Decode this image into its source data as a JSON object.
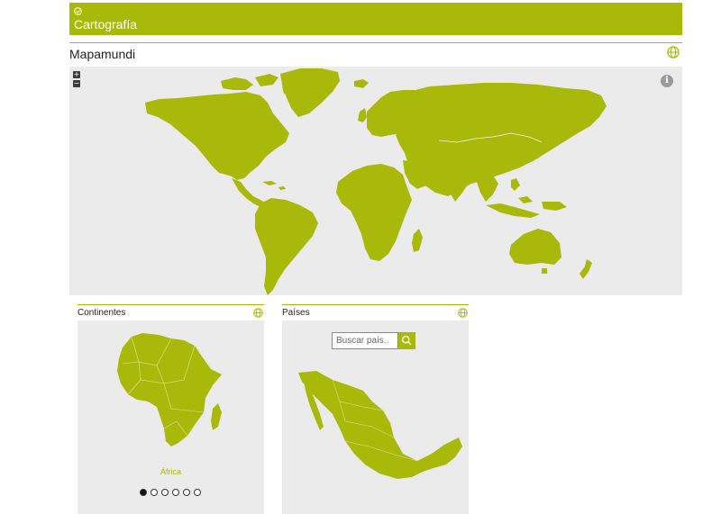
{
  "header": {
    "title": "Cartografía",
    "icon": "check-circle-icon"
  },
  "mapamundi": {
    "title": "Mapamundi",
    "zoom_in": "+",
    "zoom_out": "−",
    "info": "i",
    "map_fill": "#a9b90a",
    "map_background": "#ebebeb"
  },
  "continentes": {
    "title": "Continentes",
    "selected": "África",
    "pages": 6,
    "current_page": 1
  },
  "paises": {
    "title": "Países",
    "search_placeholder": "Buscar país..",
    "selected_country": "Mexico"
  },
  "colors": {
    "accent": "#a9b90a",
    "panel": "#ebebeb"
  }
}
